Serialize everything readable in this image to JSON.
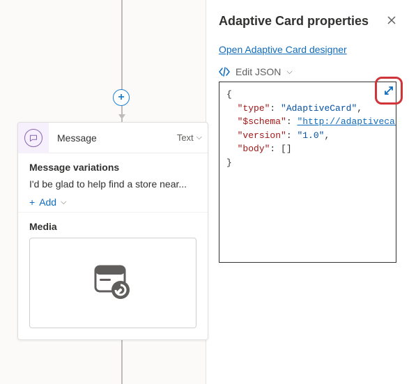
{
  "panel": {
    "title": "Adaptive Card properties",
    "designer_link": "Open Adaptive Card designer",
    "edit_label": "Edit JSON",
    "json": {
      "line1_key": "\"type\"",
      "line1_val": "\"AdaptiveCard\"",
      "line2_key": "\"$schema\"",
      "line2_val": "\"http://adaptivecards.i",
      "line3_key": "\"version\"",
      "line3_val": "\"1.0\"",
      "line4_key": "\"body\"",
      "line4_val": "[]"
    }
  },
  "card": {
    "title": "Message",
    "type_label": "Text",
    "variations_title": "Message variations",
    "variation_text": "I'd be glad to help find a store near...",
    "add_label": "Add",
    "media_title": "Media"
  }
}
